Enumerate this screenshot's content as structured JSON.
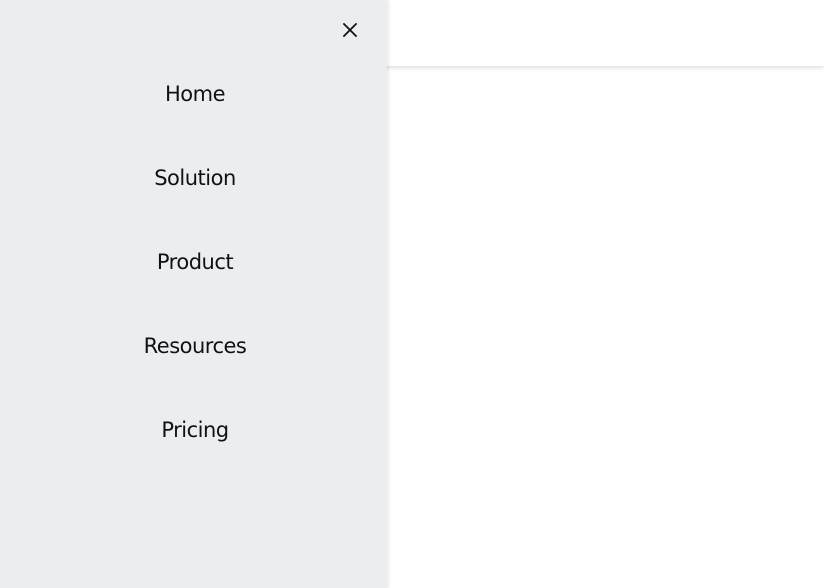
{
  "header": {
    "background_color": "#ffffff"
  },
  "drawer": {
    "background_color": "#ebeef1",
    "close_icon": "close-icon",
    "nav_items": [
      {
        "label": "Home"
      },
      {
        "label": "Solution"
      },
      {
        "label": "Product"
      },
      {
        "label": "Resources"
      },
      {
        "label": "Pricing"
      }
    ]
  }
}
